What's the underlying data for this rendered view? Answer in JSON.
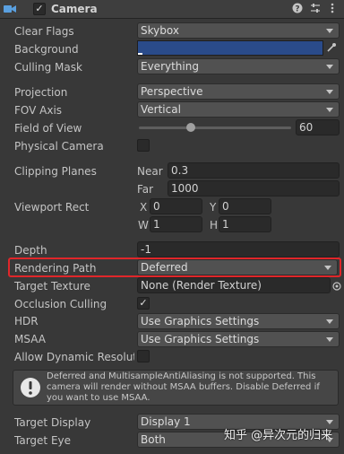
{
  "header": {
    "title": "Camera"
  },
  "fields": {
    "clear_flags": {
      "label": "Clear Flags",
      "value": "Skybox"
    },
    "background": {
      "label": "Background",
      "color": "#2a4b8a"
    },
    "culling_mask": {
      "label": "Culling Mask",
      "value": "Everything"
    },
    "projection": {
      "label": "Projection",
      "value": "Perspective"
    },
    "fov_axis": {
      "label": "FOV Axis",
      "value": "Vertical"
    },
    "field_of_view": {
      "label": "Field of View",
      "value": "60",
      "level": 0.34
    },
    "physical_camera": {
      "label": "Physical Camera",
      "checked": false
    },
    "clipping_planes": {
      "label": "Clipping Planes",
      "near_label": "Near",
      "near": "0.3",
      "far_label": "Far",
      "far": "1000"
    },
    "viewport_rect": {
      "label": "Viewport Rect",
      "x_label": "X",
      "x": "0",
      "y_label": "Y",
      "y": "0",
      "w_label": "W",
      "w": "1",
      "h_label": "H",
      "h": "1"
    },
    "depth": {
      "label": "Depth",
      "value": "-1"
    },
    "rendering_path": {
      "label": "Rendering Path",
      "value": "Deferred"
    },
    "target_texture": {
      "label": "Target Texture",
      "value": "None (Render Texture)"
    },
    "occlusion_culling": {
      "label": "Occlusion Culling",
      "checked": true,
      "check": "✓"
    },
    "hdr": {
      "label": "HDR",
      "value": "Use Graphics Settings"
    },
    "msaa": {
      "label": "MSAA",
      "value": "Use Graphics Settings"
    },
    "allow_dynamic_resolution": {
      "label": "Allow Dynamic Resoluti",
      "checked": false
    },
    "help_message": "Deferred and MultisampleAntiAliasing is not supported. This camera will render without MSAA buffers. Disable Deferred if you want to use MSAA.",
    "target_display": {
      "label": "Target Display",
      "value": "Display 1"
    },
    "target_eye": {
      "label": "Target Eye",
      "value": "Both"
    }
  },
  "watermark": "知乎 @异次元的归来",
  "colors": {
    "highlight": "#e0262a",
    "background_swatch": "#2a4b8a"
  }
}
